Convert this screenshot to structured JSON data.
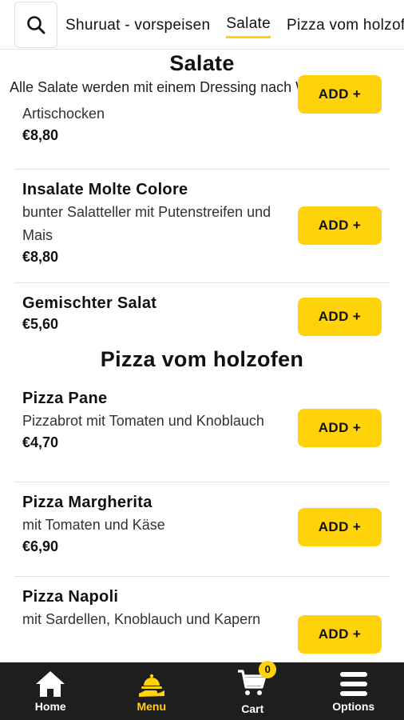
{
  "tabbar": {
    "search_icon": "search-icon",
    "tabs": [
      {
        "label": "Shuruat - vorspeisen",
        "active": false
      },
      {
        "label": "Salate",
        "active": true
      },
      {
        "label": "Pizza vom holzofen",
        "active": false
      }
    ]
  },
  "sections": [
    {
      "title": "Salate",
      "description": "Alle Salate werden mit einem Dressing nach Wahl serviert",
      "items": [
        {
          "name": "",
          "description": "Artischocken",
          "price": "€8,80",
          "button": "ADD +"
        },
        {
          "name": "Insalate Molte Colore",
          "description": "bunter Salatteller mit Putenstreifen und Mais",
          "price": "€8,80",
          "button": "ADD +"
        },
        {
          "name": "Gemischter Salat",
          "description": "",
          "price": "€5,60",
          "button": "ADD +"
        }
      ]
    },
    {
      "title": "Pizza vom holzofen",
      "items": [
        {
          "name": "Pizza Pane",
          "description": "Pizzabrot mit Tomaten und Knoblauch",
          "price": "€4,70",
          "button": "ADD +"
        },
        {
          "name": "Pizza Margherita",
          "description": "mit Tomaten und Käse",
          "price": "€6,90",
          "button": "ADD +"
        },
        {
          "name": "Pizza Napoli",
          "description": "mit Sardellen, Knoblauch und Kapern",
          "price": "",
          "button": "ADD +"
        }
      ]
    }
  ],
  "bottom_nav": [
    {
      "label": "Home",
      "icon": "home-icon",
      "active": false
    },
    {
      "label": "Menu",
      "icon": "menu-serving-icon",
      "active": true
    },
    {
      "label": "Cart",
      "icon": "cart-icon",
      "active": false,
      "badge": "0"
    },
    {
      "label": "Options",
      "icon": "hamburger-icon",
      "active": false
    }
  ],
  "colors": {
    "accent": "#FFD20A",
    "nav_bg": "#1e1e1e"
  }
}
